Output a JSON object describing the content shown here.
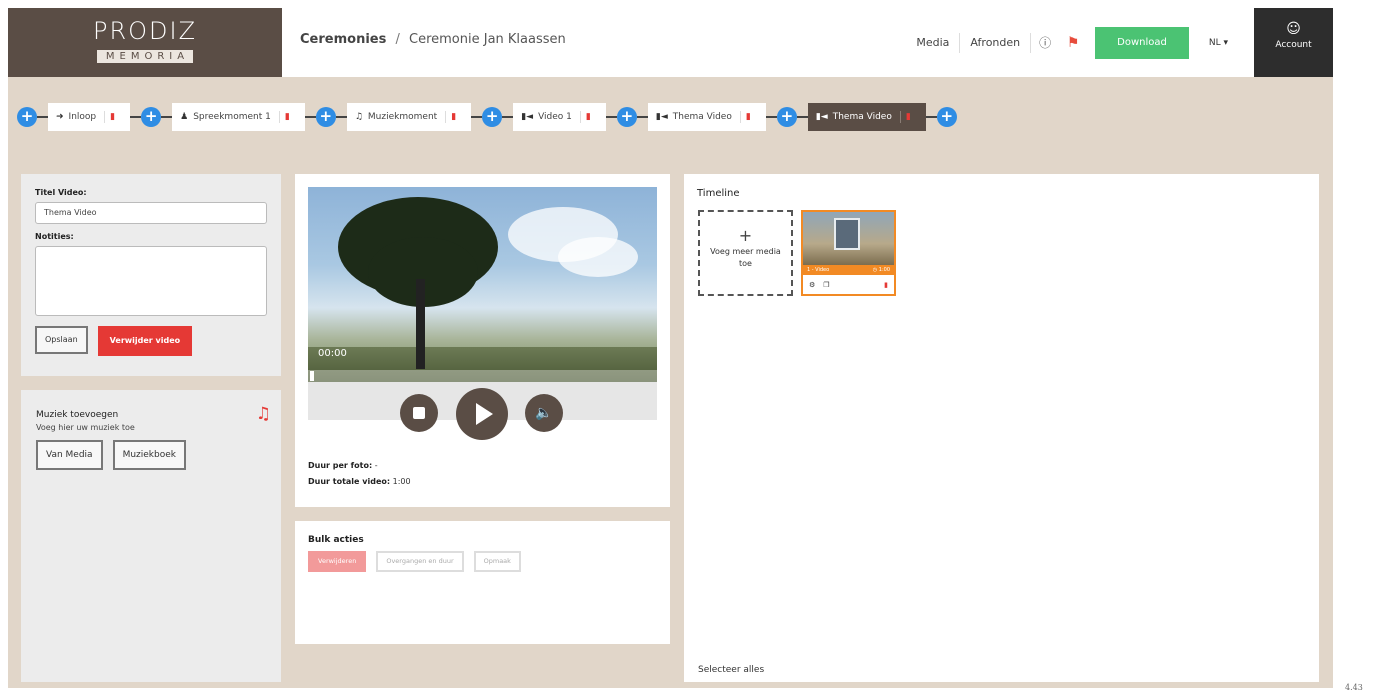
{
  "header": {
    "logo_main": "PRODIZ",
    "logo_sub": "MEMORIA",
    "breadcrumb": {
      "root": "Ceremonies",
      "separator": "/",
      "current": "Ceremonie Jan Klaassen"
    },
    "nav": {
      "media": "Media",
      "finish": "Afronden"
    },
    "download": "Download",
    "language": "NL",
    "account": "Account"
  },
  "steps": [
    {
      "label": "Inloop",
      "icon": "sign-in-icon"
    },
    {
      "label": "Spreekmoment 1",
      "icon": "person-icon"
    },
    {
      "label": "Muziekmoment",
      "icon": "music-icon"
    },
    {
      "label": "Video 1",
      "icon": "video-icon"
    },
    {
      "label": "Thema Video",
      "icon": "video-icon"
    },
    {
      "label": "Thema Video",
      "icon": "video-icon",
      "active": true
    }
  ],
  "video_form": {
    "title_label": "Titel Video:",
    "title_value": "Thema Video",
    "notes_label": "Notities:",
    "save_button": "Opslaan",
    "delete_button": "Verwijder video"
  },
  "music": {
    "title": "Muziek toevoegen",
    "subtitle": "Voeg hier uw muziek toe",
    "from_media_button": "Van Media",
    "music_book_button": "Muziekboek"
  },
  "preview": {
    "time": "00:00",
    "duration_per_photo_label": "Duur per foto:",
    "duration_per_photo_value": "-",
    "total_duration_label": "Duur totale video:",
    "total_duration_value": "1:00"
  },
  "bulk": {
    "title": "Bulk acties",
    "delete": "Verwijderen",
    "transitions": "Overgangen en duur",
    "markup": "Opmaak"
  },
  "timeline": {
    "title": "Timeline",
    "add_media": "Voeg meer media toe",
    "card": {
      "label": "1 - Video",
      "duration": "1:00"
    },
    "select_all": "Selecteer alles"
  },
  "page_number": "4.43",
  "colors": {
    "brand_brown": "#5a4d45",
    "background_beige": "#e1d6c9",
    "accent_blue": "#2f8de4",
    "danger_red": "#e53935",
    "download_green": "#4bc373",
    "timeline_orange": "#f28a24"
  }
}
